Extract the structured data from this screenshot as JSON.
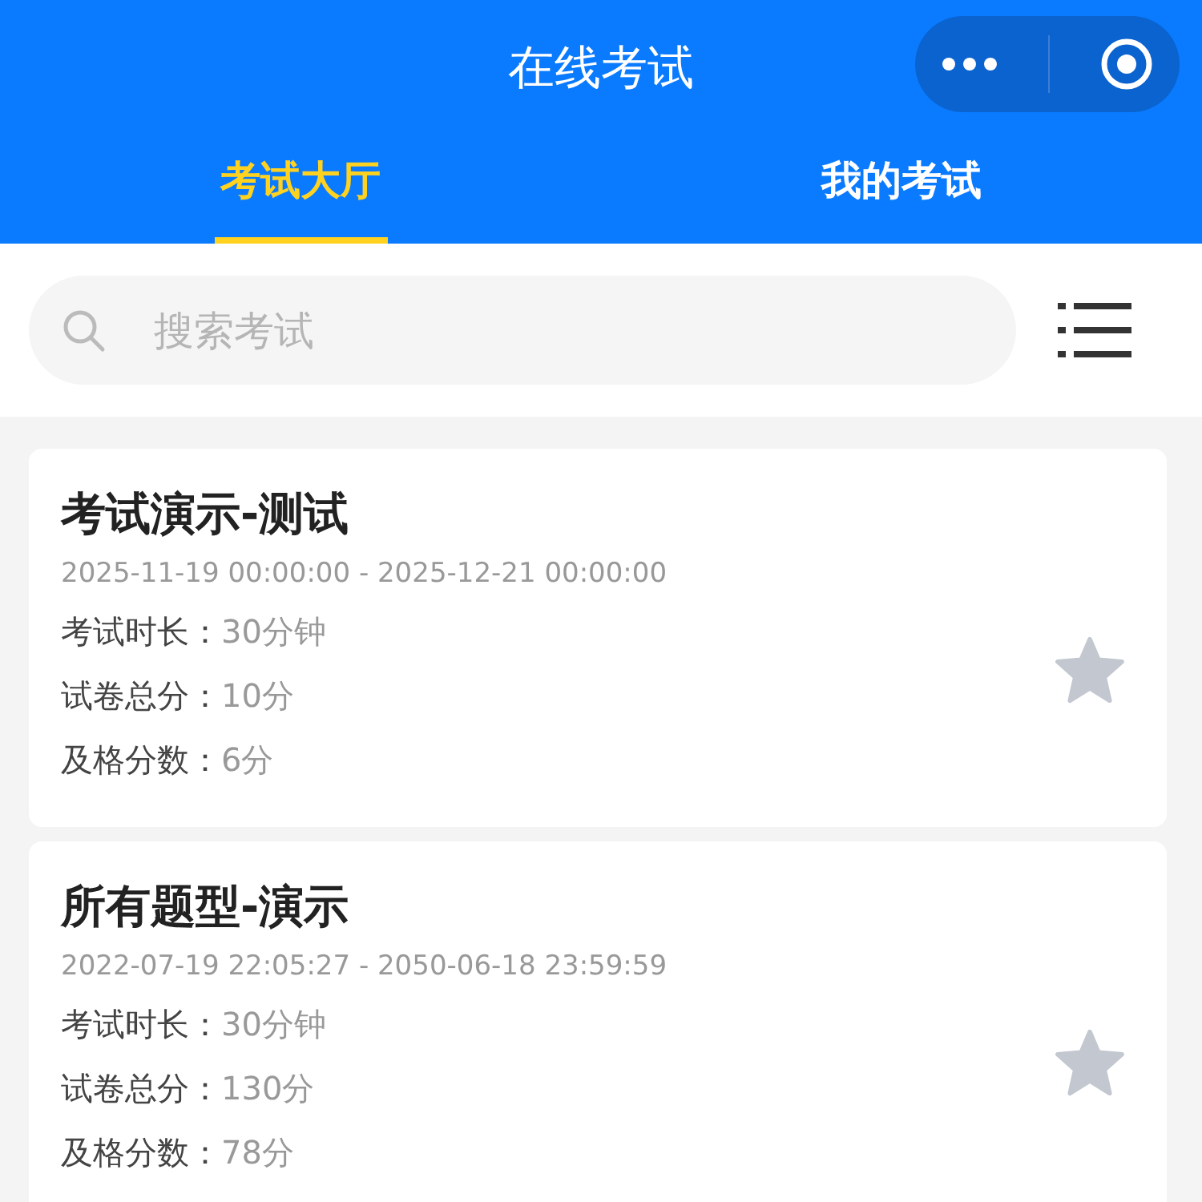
{
  "header": {
    "title": "在线考试"
  },
  "tabs": [
    {
      "label": "考试大厅",
      "selected": true
    },
    {
      "label": "我的考试",
      "selected": false
    }
  ],
  "search": {
    "placeholder": "搜索考试"
  },
  "exams": [
    {
      "title": "考试演示-测试",
      "period": "2025-11-19 00:00:00 - 2025-12-21 00:00:00",
      "favorited": false,
      "fields": [
        {
          "label": "考试时长：",
          "value": "30分钟"
        },
        {
          "label": "试卷总分：",
          "value": "10分"
        },
        {
          "label": "及格分数：",
          "value": "6分"
        }
      ]
    },
    {
      "title": "所有题型-演示",
      "period": "2022-07-19 22:05:27 - 2050-06-18 23:59:59",
      "favorited": false,
      "fields": [
        {
          "label": "考试时长：",
          "value": "30分钟"
        },
        {
          "label": "试卷总分：",
          "value": "130分"
        },
        {
          "label": "及格分数：",
          "value": "78分"
        }
      ]
    }
  ]
}
